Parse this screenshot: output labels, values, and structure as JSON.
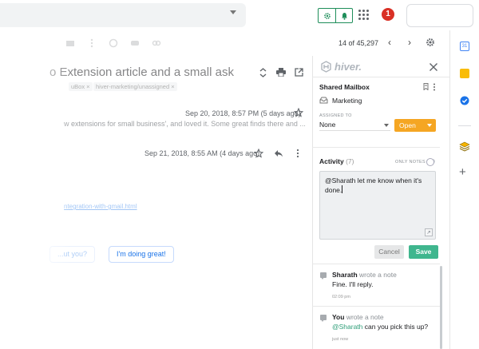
{
  "header": {
    "notification_count": "1"
  },
  "toolbar": {
    "page_counter": "14 of 45,297",
    "prev_label": "‹",
    "next_label": "›"
  },
  "email": {
    "subject": "o Extension article and a small ask",
    "labels": [
      "uBox ×",
      "hiver-marketing/unassigned ×"
    ],
    "messages": [
      {
        "date": "Sep 20, 2018, 8:57 PM (5 days ago)",
        "snippet": "w extensions for small business', and loved it. Some great finds there and ..."
      },
      {
        "date": "Sep 21, 2018, 8:55 AM (4 days ago)"
      }
    ],
    "link": "ntegration-with-gmail.html",
    "smart_replies": [
      "...ut you?",
      "I'm doing great!"
    ]
  },
  "hiver_panel": {
    "logo_text": "hiver.",
    "shared_mailbox_heading": "Shared Mailbox",
    "mailbox_name": "Marketing",
    "assigned_to_label": "ASSIGNED TO",
    "assignee_value": "None",
    "status_value": "Open",
    "activity_heading": "Activity",
    "activity_count": "(7)",
    "only_notes_label": "ONLY NOTES",
    "note_draft": "@Sharath let me know when it's done.",
    "cancel_label": "Cancel",
    "save_label": "Save",
    "notes": [
      {
        "author": "Sharath",
        "action": "wrote a note",
        "body": "Fine. I'll reply.",
        "time": "02:09 pm"
      },
      {
        "author": "You",
        "action": "wrote a note",
        "mention": "@Sharath",
        "body": " can you pick this up?",
        "time": "just now"
      }
    ]
  },
  "side_rail": {
    "calendar_text": "31",
    "icons": [
      "calendar-icon",
      "keep-icon",
      "tasks-icon",
      "hiver-stack-icon",
      "add-addon-icon"
    ]
  },
  "colors": {
    "hiver_green": "#3fb68e",
    "status_orange": "#f5a623",
    "badge_red": "#d93025",
    "extension_green": "#1e8e5a"
  }
}
